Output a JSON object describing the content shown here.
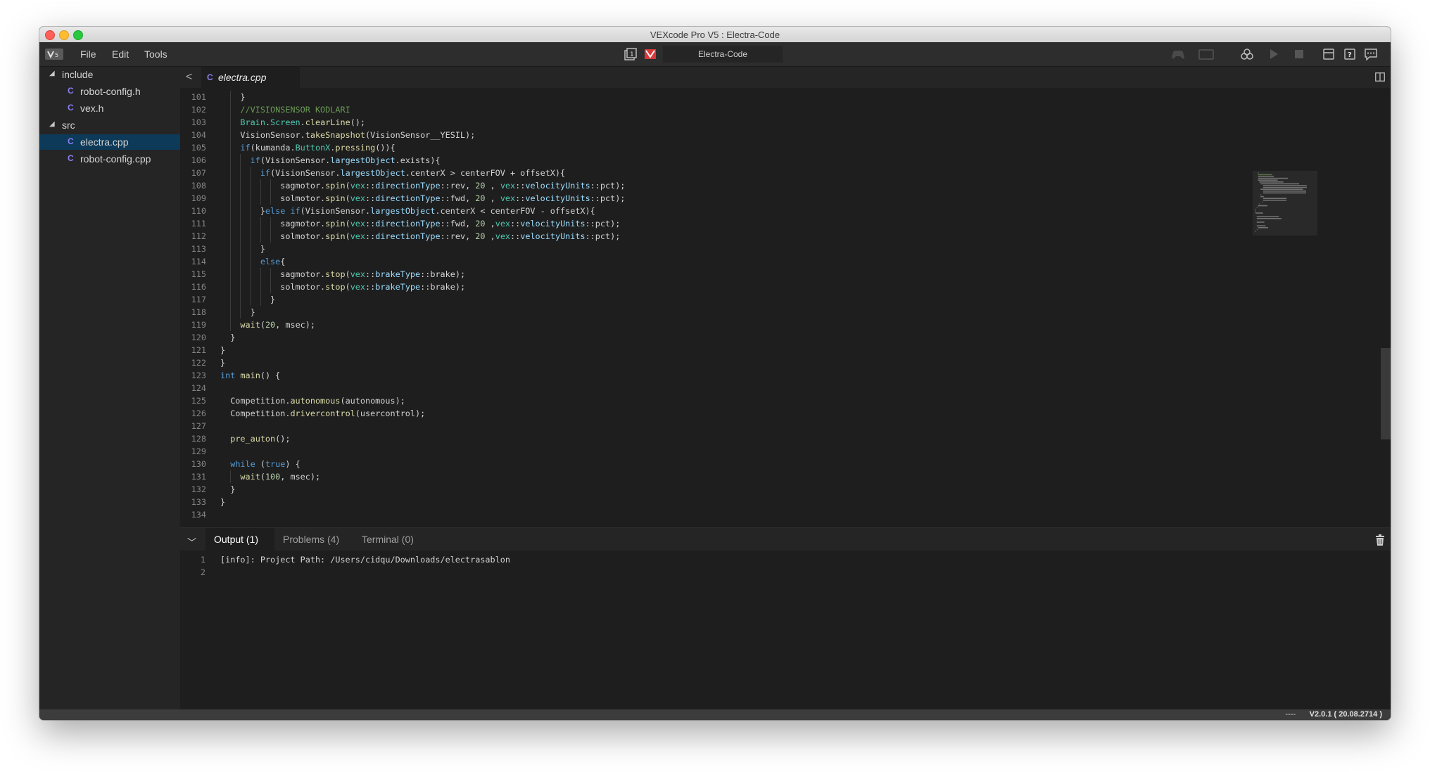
{
  "window": {
    "title": "VEXcode Pro V5 : Electra-Code"
  },
  "menu": {
    "items": [
      "File",
      "Edit",
      "Tools"
    ]
  },
  "toolbar": {
    "project_name": "Electra-Code"
  },
  "icons": {
    "app_logo": "vex-logo-icon",
    "slot": "slot-icon",
    "brain_status": "brain-status-icon",
    "controller": "controller-icon",
    "brain": "brain-icon",
    "download": "download-icon",
    "play": "play-icon",
    "stop": "stop-icon",
    "devices": "devices-icon",
    "help": "help-icon",
    "feedback": "feedback-icon",
    "cpp_file": "cpp-file-icon",
    "split_editor": "split-editor-icon",
    "trash": "trash-icon"
  },
  "colors": {
    "selected_file": "#0d3a58",
    "keyword": "#569cd6",
    "comment": "#6a9955",
    "function": "#dcdcaa",
    "type": "#4ec9b0"
  },
  "explorer": {
    "folders": [
      {
        "name": "include",
        "files": [
          "robot-config.h",
          "vex.h"
        ]
      },
      {
        "name": "src",
        "files": [
          "electra.cpp",
          "robot-config.cpp"
        ]
      }
    ],
    "selected_file": "electra.cpp"
  },
  "editor": {
    "tab_label": "electra.cpp",
    "lines": [
      {
        "n": "101",
        "t": "    }"
      },
      {
        "n": "102",
        "t": "    //VISIONSENSOR KODLARI"
      },
      {
        "n": "103",
        "t": "    Brain.Screen.clearLine();"
      },
      {
        "n": "104",
        "t": "    VisionSensor.takeSnapshot(VisionSensor__YESIL);"
      },
      {
        "n": "105",
        "t": "    if(kumanda.ButtonX.pressing()){"
      },
      {
        "n": "106",
        "t": "      if(VisionSensor.largestObject.exists){"
      },
      {
        "n": "107",
        "t": "        if(VisionSensor.largestObject.centerX > centerFOV + offsetX){"
      },
      {
        "n": "108",
        "t": "            sagmotor.spin(vex::directionType::rev, 20 , vex::velocityUnits::pct);"
      },
      {
        "n": "109",
        "t": "            solmotor.spin(vex::directionType::fwd, 20 , vex::velocityUnits::pct);"
      },
      {
        "n": "110",
        "t": "        }else if(VisionSensor.largestObject.centerX < centerFOV - offsetX){"
      },
      {
        "n": "111",
        "t": "            sagmotor.spin(vex::directionType::fwd, 20 ,vex::velocityUnits::pct);"
      },
      {
        "n": "112",
        "t": "            solmotor.spin(vex::directionType::rev, 20 ,vex::velocityUnits::pct);"
      },
      {
        "n": "113",
        "t": "        }"
      },
      {
        "n": "114",
        "t": "        else{"
      },
      {
        "n": "115",
        "t": "            sagmotor.stop(vex::brakeType::brake);"
      },
      {
        "n": "116",
        "t": "            solmotor.stop(vex::brakeType::brake);"
      },
      {
        "n": "117",
        "t": "          }"
      },
      {
        "n": "118",
        "t": "      }"
      },
      {
        "n": "119",
        "t": "    wait(20, msec);"
      },
      {
        "n": "120",
        "t": "  }"
      },
      {
        "n": "121",
        "t": "}"
      },
      {
        "n": "122",
        "t": "}"
      },
      {
        "n": "123",
        "t": "int main() {"
      },
      {
        "n": "124",
        "t": ""
      },
      {
        "n": "125",
        "t": "  Competition.autonomous(autonomous);"
      },
      {
        "n": "126",
        "t": "  Competition.drivercontrol(usercontrol);"
      },
      {
        "n": "127",
        "t": ""
      },
      {
        "n": "128",
        "t": "  pre_auton();"
      },
      {
        "n": "129",
        "t": ""
      },
      {
        "n": "130",
        "t": "  while (true) {"
      },
      {
        "n": "131",
        "t": "    wait(100, msec);"
      },
      {
        "n": "132",
        "t": "  }"
      },
      {
        "n": "133",
        "t": "}"
      },
      {
        "n": "134",
        "t": ""
      }
    ]
  },
  "panel": {
    "tabs": [
      "Output (1)",
      "Problems (4)",
      "Terminal (0)"
    ],
    "active_tab": "Output (1)",
    "output_lines": [
      {
        "n": "1",
        "t": "[info]: Project Path: /Users/cidqu/Downloads/electrasablon"
      },
      {
        "n": "2",
        "t": ""
      }
    ]
  },
  "status": {
    "left": "----",
    "version": "V2.0.1 ( 20.08.2714 )"
  }
}
